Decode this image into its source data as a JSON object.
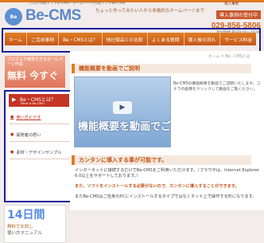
{
  "header": {
    "tagline": "ブログ作成ソフトB-CMS・ホームページ作成ソフトBe-CMS",
    "logo_badge": "Be",
    "logo_text": "Be-CMS",
    "catch": "ちょっと作ってみたい人から本格的なホームページまで",
    "link": "導入事例",
    "contact_label": "導入事例の受付中",
    "phone": "029-856-5806",
    "hours": "受付時間 平日9:00〜18:00"
  },
  "nav": {
    "items": [
      "ホーム",
      "ご活用事例",
      "Be・CMSとは？",
      "他社製品との比較",
      "よくある質問",
      "導入後の流れ",
      "サービス料金"
    ]
  },
  "sidebar": {
    "banner_small": "ブログより簡単すぎるホームページ作成",
    "banner_big": "無料 今すぐ",
    "box_title": "Be・CMSとは？",
    "box_subtitle": "What is Be-CMS?",
    "links": [
      "使い方ビデオ",
      "開発者の想い",
      "素材・デザインサンプル"
    ],
    "promo_big": "14日間",
    "promo_mid": "無料でお試し",
    "promo_small": "使い方マニュアル"
  },
  "main": {
    "breadcrumb": "ホーム > Be・CMSとは",
    "section1_title": "機能概要を動画でご説明",
    "video_caption": "機能概要を動画でご説明いたします",
    "video_desc": "Be-CMSの機能概要を動画でご説明いたします。コチラの画像をクリックして動画をご覧ください。",
    "section2_title": "カンタンに導入する事が可能です。",
    "para1": "インターネットに接続するだけでBe-CMSをご利用いただけます。（ブラウザは、Internet Explorer 6.0以上をサポートしております。）",
    "para2": "また、ソフトをインストールする必要がないので、カンタンに導入することができます。",
    "para3": "またBe-CMSはご自身のPCにインストールするタイプではなくネット上で操作する形になります。"
  }
}
